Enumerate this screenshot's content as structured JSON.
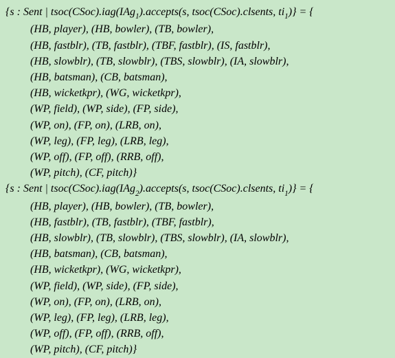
{
  "block1": {
    "header": "{s : Sent | tsoc(CSoc).iag(IAg₁).accepts(s, tsoc(CSoc).clsents, ti₁)} = {",
    "lines": [
      "(HB, player), (HB, bowler), (TB, bowler),",
      "(HB, fastblr), (TB, fastblr), (TBF, fastblr), (IS, fastblr),",
      "(HB, slowblr), (TB, slowblr), (TBS, slowblr), (IA, slowblr),",
      "(HB, batsman), (CB, batsman),",
      "(HB, wicketkpr), (WG, wicketkpr),",
      "(WP, field), (WP, side), (FP, side),",
      "(WP, on), (FP, on), (LRB, on),",
      "(WP, leg), (FP, leg), (LRB, leg),",
      "(WP, off), (FP, off), (RRB, off),",
      "(WP, pitch), (CF, pitch)}"
    ]
  },
  "block2": {
    "header": "{s : Sent | tsoc(CSoc).iag(IAg₂).accepts(s, tsoc(CSoc).clsents, ti₁)} = {",
    "lines": [
      "(HB, player), (HB, bowler), (TB, bowler),",
      "(HB, fastblr), (TB, fastblr), (TBF, fastblr),",
      "(HB, slowblr), (TB, slowblr), (TBS, slowblr), (IA, slowblr),",
      "(HB, batsman), (CB, batsman),",
      "(HB, wicketkpr), (WG, wicketkpr),",
      "(WP, field), (WP, side), (FP, side),",
      "(WP, on), (FP, on), (LRB, on),",
      "(WP, leg), (FP, leg), (LRB, leg),",
      "(WP, off), (FP, off), (RRB, off),",
      "(WP, pitch), (CF, pitch)}"
    ]
  }
}
